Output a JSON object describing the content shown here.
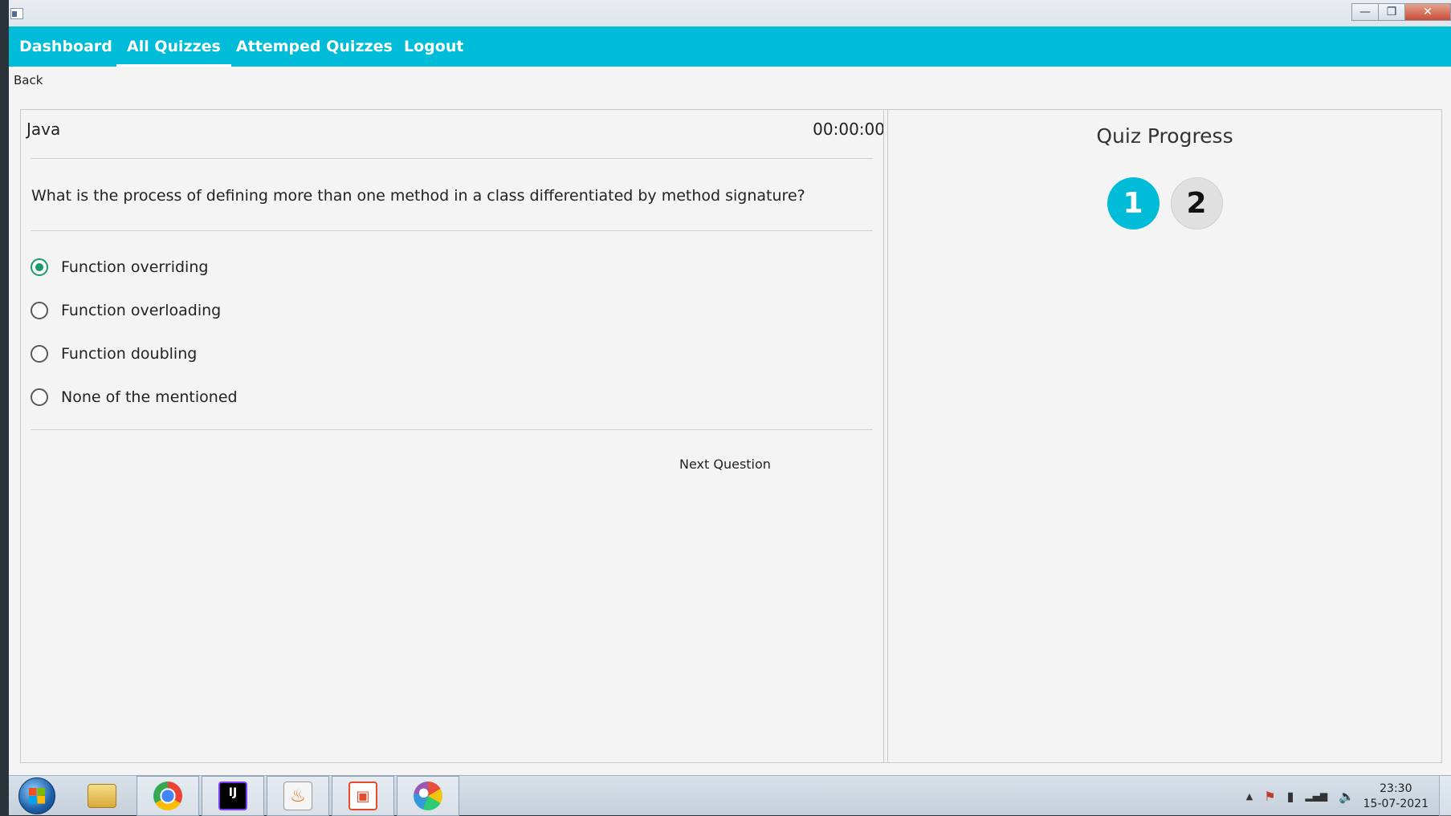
{
  "window": {
    "controls": {
      "minimize": "—",
      "restore": "❐",
      "close": "✕"
    }
  },
  "nav": {
    "items": [
      {
        "label": "Dashboard"
      },
      {
        "label": "All Quizzes",
        "active": true
      },
      {
        "label": "Attemped Quizzes"
      },
      {
        "label": "Logout"
      }
    ]
  },
  "back_label": "Back",
  "quiz": {
    "title": "Java",
    "timer": "00:00:00",
    "question": "What is the process of defining more than one method in a class differentiated by method signature?",
    "options": [
      {
        "label": "Function overriding",
        "selected": true
      },
      {
        "label": "Function overloading",
        "selected": false
      },
      {
        "label": "Function doubling",
        "selected": false
      },
      {
        "label": "None of the mentioned",
        "selected": false
      }
    ],
    "next_label": "Next Question"
  },
  "progress": {
    "title": "Quiz Progress",
    "steps": [
      {
        "label": "1",
        "state": "current"
      },
      {
        "label": "2",
        "state": "pending"
      }
    ]
  },
  "colors": {
    "accent": "#00bcd8",
    "radio_selected": "#1a9a6a"
  },
  "taskbar": {
    "apps": [
      "start-icon",
      "file-explorer-icon",
      "chrome-icon",
      "intellij-idea-icon",
      "java-icon",
      "reader-icon",
      "paint-icon"
    ],
    "idea_glyph": "IJ",
    "java_glyph": "♨",
    "reader_glyph": "▣",
    "tray": {
      "chevron": "▲",
      "flag": "⚑",
      "battery": "▮",
      "signal": "▂▄▆",
      "volume": "🔈"
    },
    "clock": {
      "time": "23:30",
      "date": "15-07-2021"
    }
  }
}
